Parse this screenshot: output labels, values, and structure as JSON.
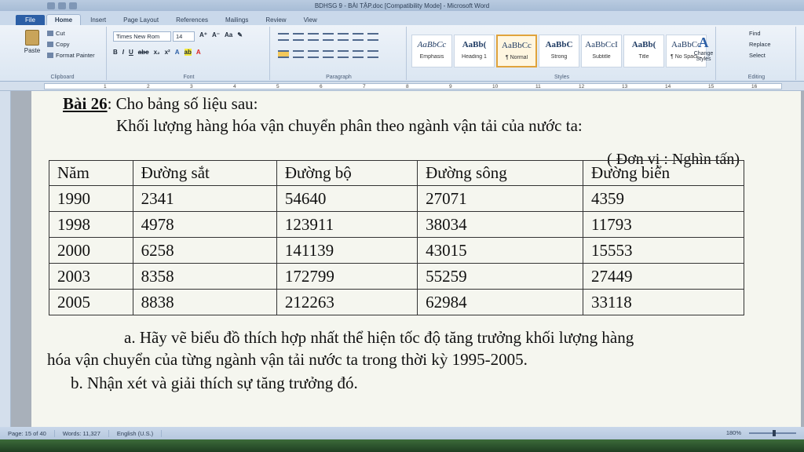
{
  "window": {
    "title": "BDHSG 9 - BÀI TẬP.doc [Compatibility Mode] - Microsoft Word"
  },
  "ribbon": {
    "tabs": [
      {
        "label": "File"
      },
      {
        "label": "Home"
      },
      {
        "label": "Insert"
      },
      {
        "label": "Page Layout"
      },
      {
        "label": "References"
      },
      {
        "label": "Mailings"
      },
      {
        "label": "Review"
      },
      {
        "label": "View"
      }
    ],
    "clipboard": {
      "paste_label": "Paste",
      "cut_label": "Cut",
      "copy_label": "Copy",
      "format_painter_label": "Format Painter",
      "group_label": "Clipboard"
    },
    "font": {
      "name": "Times New Rom",
      "size": "14",
      "group_label": "Font"
    },
    "paragraph": {
      "group_label": "Paragraph"
    },
    "styles": {
      "items": [
        {
          "sample": "AaBbCc",
          "name": "Emphasis"
        },
        {
          "sample": "AaBb(",
          "name": "Heading 1"
        },
        {
          "sample": "AaBbCc",
          "name": "¶ Normal"
        },
        {
          "sample": "AaBbC",
          "name": "Strong"
        },
        {
          "sample": "AaBbCcI",
          "name": "Subtitle"
        },
        {
          "sample": "AaBb(",
          "name": "Title"
        },
        {
          "sample": "AaBbCc",
          "name": "¶ No Spaci..."
        }
      ],
      "change_styles_label": "Change Styles",
      "group_label": "Styles"
    },
    "editing": {
      "find_label": "Find",
      "replace_label": "Replace",
      "select_label": "Select",
      "group_label": "Editing"
    }
  },
  "ruler": {
    "numbers": [
      "1",
      "2",
      "3",
      "4",
      "5",
      "6",
      "7",
      "8",
      "9",
      "10",
      "11",
      "12",
      "13",
      "14",
      "15",
      "16"
    ]
  },
  "document": {
    "heading_bold": "Bài 26",
    "heading_rest": ": Cho bảng số liệu sau:",
    "subtitle": "Khối lượng hàng hóa vận chuyển phân theo ngành vận tải của nước ta:",
    "unit": "( Đơn vị : Nghìn tấn)",
    "table": {
      "headers": [
        "Năm",
        "Đường sắt",
        "Đường bộ",
        "Đường sông",
        "Đường biển"
      ],
      "rows": [
        [
          "1990",
          "2341",
          "54640",
          "27071",
          "4359"
        ],
        [
          "1998",
          "4978",
          "123911",
          "38034",
          "11793"
        ],
        [
          "2000",
          "6258",
          "141139",
          "43015",
          "15553"
        ],
        [
          "2003",
          "8358",
          "172799",
          "55259",
          "27449"
        ],
        [
          "2005",
          "8838",
          "212263",
          "62984",
          "33118"
        ]
      ]
    },
    "question_a_line1": "a. Hãy vẽ biểu đồ thích hợp nhất thể hiện tốc độ tăng trưởng khối lượng hàng",
    "question_a_line2": "hóa vận chuyển của từng ngành vận tải nước ta trong thời kỳ 1995-2005.",
    "question_b": "b. Nhận xét và giải thích sự tăng trưởng đó."
  },
  "status": {
    "page": "Page: 15 of 40",
    "words": "Words: 11,327",
    "language": "English (U.S.)",
    "zoom": "180%"
  }
}
